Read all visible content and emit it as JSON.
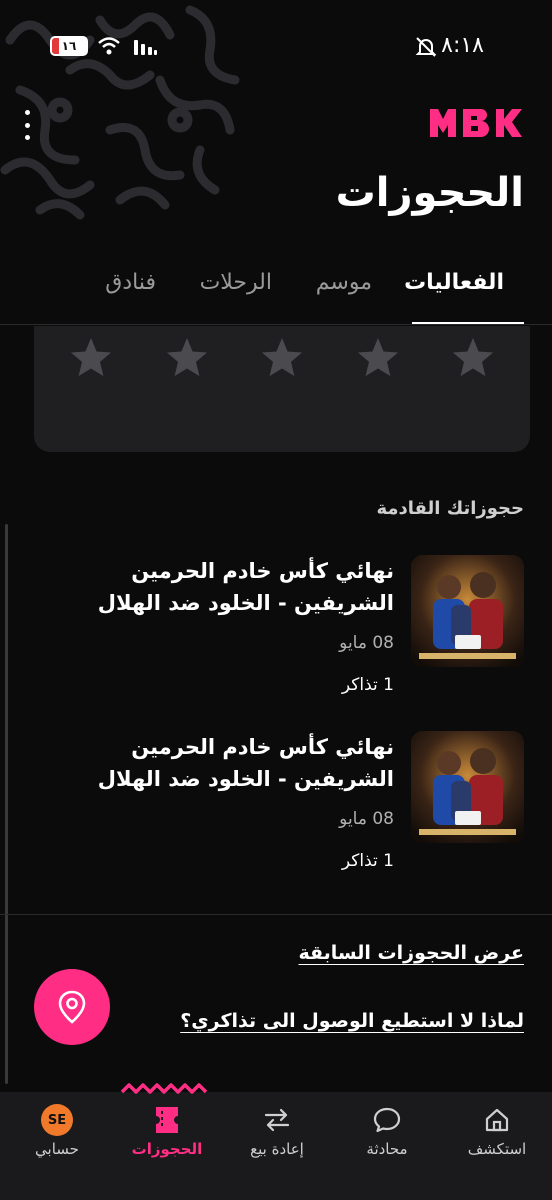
{
  "status_bar": {
    "time": "٨:١٨",
    "battery": "١٦"
  },
  "header": {
    "brand_logo": "MBK",
    "title": "الحجوزات",
    "accent_color": "#ff2e84"
  },
  "tabs": [
    {
      "label": "الفعاليات",
      "active": true
    },
    {
      "label": "موسم",
      "active": false
    },
    {
      "label": "الرحلات",
      "active": false
    },
    {
      "label": "فنادق",
      "active": false
    }
  ],
  "rating": {
    "stars": 5,
    "filled": 0
  },
  "upcoming": {
    "title": "حجوزاتك القادمة",
    "items": [
      {
        "title": "نهائي كأس خادم الحرمين الشريفين - الخلود ضد الهلال",
        "date": "08 مايو",
        "tickets": "1 تذاكر"
      },
      {
        "title": "نهائي كأس خادم الحرمين الشريفين - الخلود ضد الهلال",
        "date": "08 مايو",
        "tickets": "1 تذاكر"
      }
    ]
  },
  "links": {
    "past_bookings": "عرض الحجوزات السابقة",
    "access_help": "لماذا لا استطيع الوصول الى تذاكري؟"
  },
  "bottom_nav": [
    {
      "label": "استكشف",
      "icon": "home-icon",
      "active": false
    },
    {
      "label": "محادثة",
      "icon": "chat-icon",
      "active": false
    },
    {
      "label": "إعادة بيع",
      "icon": "swap-icon",
      "active": false
    },
    {
      "label": "الحجوزات",
      "icon": "ticket-icon",
      "active": true
    },
    {
      "label": "حسابي",
      "icon": "avatar",
      "active": false,
      "avatar_text": "SE"
    }
  ]
}
